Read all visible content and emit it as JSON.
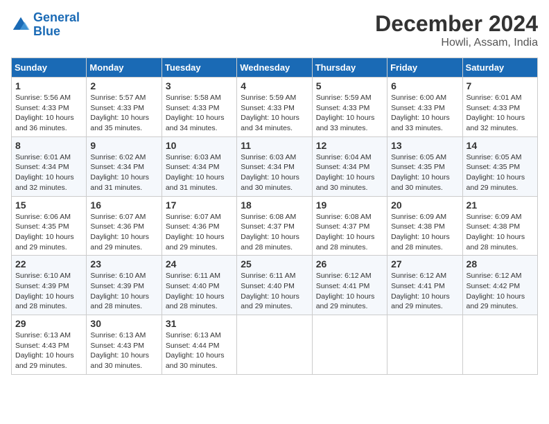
{
  "header": {
    "logo_line1": "General",
    "logo_line2": "Blue",
    "month_title": "December 2024",
    "location": "Howli, Assam, India"
  },
  "weekdays": [
    "Sunday",
    "Monday",
    "Tuesday",
    "Wednesday",
    "Thursday",
    "Friday",
    "Saturday"
  ],
  "weeks": [
    [
      {
        "day": "1",
        "sunrise": "5:56 AM",
        "sunset": "4:33 PM",
        "daylight": "10 hours and 36 minutes."
      },
      {
        "day": "2",
        "sunrise": "5:57 AM",
        "sunset": "4:33 PM",
        "daylight": "10 hours and 35 minutes."
      },
      {
        "day": "3",
        "sunrise": "5:58 AM",
        "sunset": "4:33 PM",
        "daylight": "10 hours and 34 minutes."
      },
      {
        "day": "4",
        "sunrise": "5:59 AM",
        "sunset": "4:33 PM",
        "daylight": "10 hours and 34 minutes."
      },
      {
        "day": "5",
        "sunrise": "5:59 AM",
        "sunset": "4:33 PM",
        "daylight": "10 hours and 33 minutes."
      },
      {
        "day": "6",
        "sunrise": "6:00 AM",
        "sunset": "4:33 PM",
        "daylight": "10 hours and 33 minutes."
      },
      {
        "day": "7",
        "sunrise": "6:01 AM",
        "sunset": "4:33 PM",
        "daylight": "10 hours and 32 minutes."
      }
    ],
    [
      {
        "day": "8",
        "sunrise": "6:01 AM",
        "sunset": "4:34 PM",
        "daylight": "10 hours and 32 minutes."
      },
      {
        "day": "9",
        "sunrise": "6:02 AM",
        "sunset": "4:34 PM",
        "daylight": "10 hours and 31 minutes."
      },
      {
        "day": "10",
        "sunrise": "6:03 AM",
        "sunset": "4:34 PM",
        "daylight": "10 hours and 31 minutes."
      },
      {
        "day": "11",
        "sunrise": "6:03 AM",
        "sunset": "4:34 PM",
        "daylight": "10 hours and 30 minutes."
      },
      {
        "day": "12",
        "sunrise": "6:04 AM",
        "sunset": "4:34 PM",
        "daylight": "10 hours and 30 minutes."
      },
      {
        "day": "13",
        "sunrise": "6:05 AM",
        "sunset": "4:35 PM",
        "daylight": "10 hours and 30 minutes."
      },
      {
        "day": "14",
        "sunrise": "6:05 AM",
        "sunset": "4:35 PM",
        "daylight": "10 hours and 29 minutes."
      }
    ],
    [
      {
        "day": "15",
        "sunrise": "6:06 AM",
        "sunset": "4:35 PM",
        "daylight": "10 hours and 29 minutes."
      },
      {
        "day": "16",
        "sunrise": "6:07 AM",
        "sunset": "4:36 PM",
        "daylight": "10 hours and 29 minutes."
      },
      {
        "day": "17",
        "sunrise": "6:07 AM",
        "sunset": "4:36 PM",
        "daylight": "10 hours and 29 minutes."
      },
      {
        "day": "18",
        "sunrise": "6:08 AM",
        "sunset": "4:37 PM",
        "daylight": "10 hours and 28 minutes."
      },
      {
        "day": "19",
        "sunrise": "6:08 AM",
        "sunset": "4:37 PM",
        "daylight": "10 hours and 28 minutes."
      },
      {
        "day": "20",
        "sunrise": "6:09 AM",
        "sunset": "4:38 PM",
        "daylight": "10 hours and 28 minutes."
      },
      {
        "day": "21",
        "sunrise": "6:09 AM",
        "sunset": "4:38 PM",
        "daylight": "10 hours and 28 minutes."
      }
    ],
    [
      {
        "day": "22",
        "sunrise": "6:10 AM",
        "sunset": "4:39 PM",
        "daylight": "10 hours and 28 minutes."
      },
      {
        "day": "23",
        "sunrise": "6:10 AM",
        "sunset": "4:39 PM",
        "daylight": "10 hours and 28 minutes."
      },
      {
        "day": "24",
        "sunrise": "6:11 AM",
        "sunset": "4:40 PM",
        "daylight": "10 hours and 28 minutes."
      },
      {
        "day": "25",
        "sunrise": "6:11 AM",
        "sunset": "4:40 PM",
        "daylight": "10 hours and 29 minutes."
      },
      {
        "day": "26",
        "sunrise": "6:12 AM",
        "sunset": "4:41 PM",
        "daylight": "10 hours and 29 minutes."
      },
      {
        "day": "27",
        "sunrise": "6:12 AM",
        "sunset": "4:41 PM",
        "daylight": "10 hours and 29 minutes."
      },
      {
        "day": "28",
        "sunrise": "6:12 AM",
        "sunset": "4:42 PM",
        "daylight": "10 hours and 29 minutes."
      }
    ],
    [
      {
        "day": "29",
        "sunrise": "6:13 AM",
        "sunset": "4:43 PM",
        "daylight": "10 hours and 29 minutes."
      },
      {
        "day": "30",
        "sunrise": "6:13 AM",
        "sunset": "4:43 PM",
        "daylight": "10 hours and 30 minutes."
      },
      {
        "day": "31",
        "sunrise": "6:13 AM",
        "sunset": "4:44 PM",
        "daylight": "10 hours and 30 minutes."
      },
      null,
      null,
      null,
      null
    ]
  ]
}
